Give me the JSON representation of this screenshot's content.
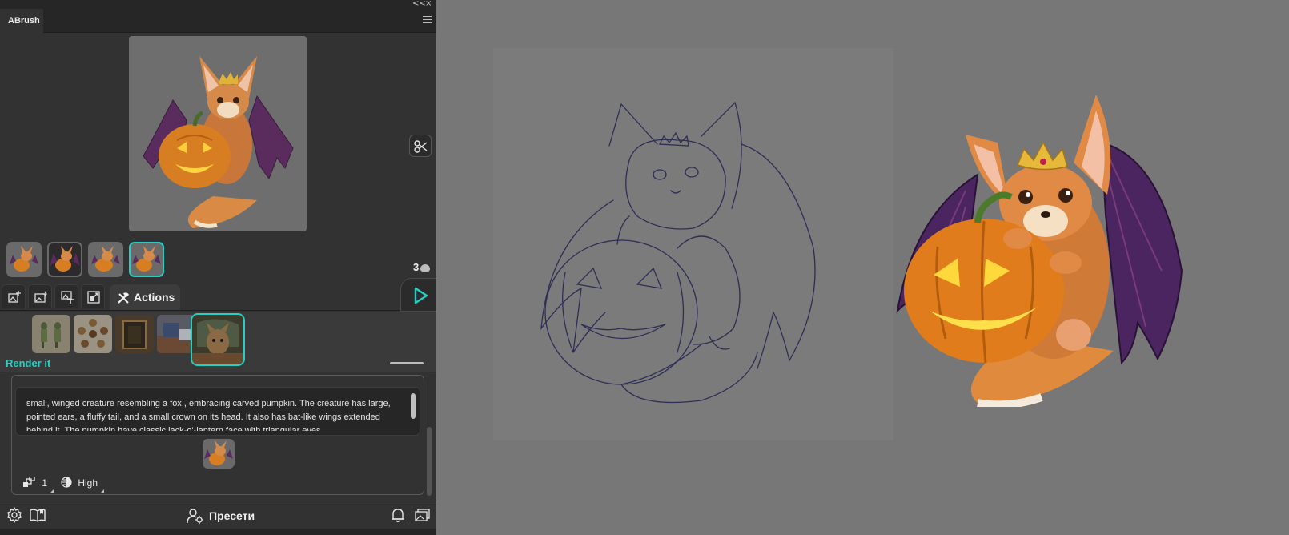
{
  "panel": {
    "tab_title": "ABrush",
    "controls": {
      "collapse": "<<",
      "close": "×"
    },
    "credits": "3",
    "actions_label": "Actions",
    "style_caption": "Render it",
    "prompt": "small, winged creature resembling a fox , embracing  carved pumpkin. The creature has large, pointed ears, a fluffy tail, and a small crown on its head. It also has bat-like wings extended behind it. The pumpkin have classic jack-o'-lantern face with triangular eyes",
    "options": {
      "count": "1",
      "quality": "High"
    },
    "presets_label": "Пресети"
  },
  "colors": {
    "accent": "#23d1c4",
    "panel_bg": "#323232",
    "canvas_bg": "#777777"
  },
  "icons": [
    "scissors-icon",
    "play-icon",
    "gear-icon",
    "book-icon",
    "bell-icon",
    "gallery-icon",
    "user-settings-icon"
  ]
}
